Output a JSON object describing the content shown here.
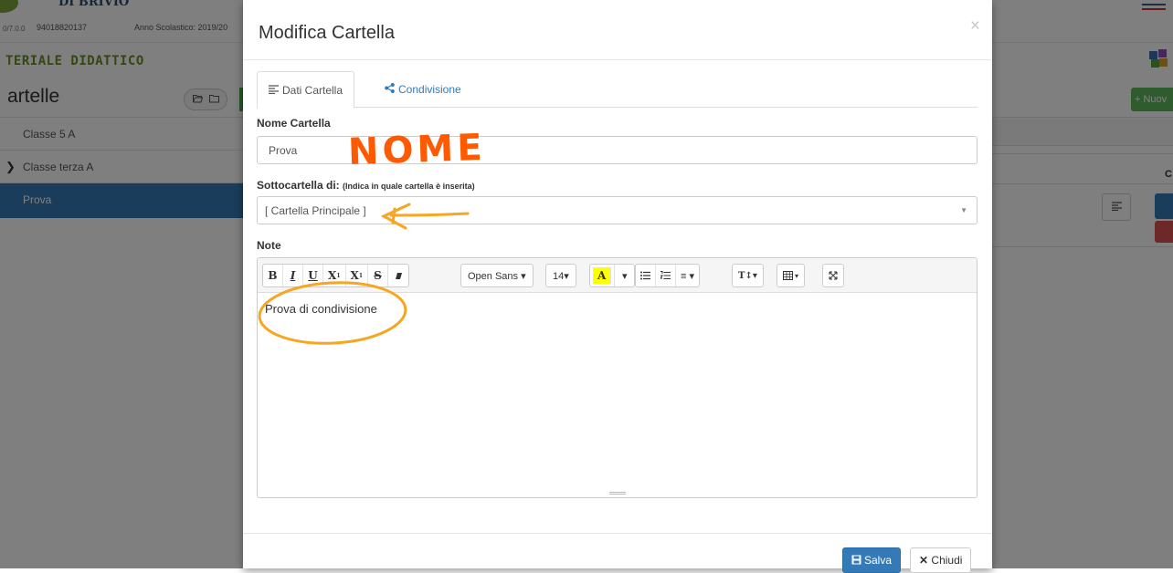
{
  "app": {
    "school_name": "DI BRIVIO",
    "version": "0/7.0.0",
    "code": "94018820137",
    "anno": "Anno Scolastico: 2019/20",
    "section_title": "TERIALE DIDATTICO",
    "list_title": "artelle",
    "new_button": "+ Nuov",
    "column_letter": "C",
    "folders": [
      {
        "label": "Classe 5 A",
        "expandable": false,
        "active": false
      },
      {
        "label": "Classe terza A",
        "expandable": true,
        "active": false
      },
      {
        "label": "Prova",
        "expandable": false,
        "active": true
      }
    ],
    "icons": {
      "folder_open": "folder-open-icon",
      "folder": "folder-icon",
      "puzzle": "puzzle-icon",
      "menu": "align-icon"
    }
  },
  "modal": {
    "title": "Modifica Cartella",
    "close": "×",
    "tabs": [
      {
        "label": "Dati Cartella",
        "icon": "align-left-icon",
        "active": true
      },
      {
        "label": "Condivisione",
        "icon": "share-icon",
        "active": false
      }
    ],
    "name_label": "Nome Cartella",
    "name_value": "Prova",
    "parent_label": "Sottocartella di:",
    "parent_hint": "(Indica in quale cartella è inserita)",
    "parent_value": "[ Cartella Principale ]",
    "note_label": "Note",
    "note_content": "Prova di condivisione",
    "toolbar": {
      "bold": "B",
      "italic": "I",
      "underline": "U",
      "superscript": "X",
      "subscript": "X",
      "strike": "S",
      "eraser": "eraser-icon",
      "font_family": "Open Sans ▾",
      "font_size": "14▾",
      "color": "A",
      "color_caret": "▾",
      "ul": "list-ul-icon",
      "ol": "list-ol-icon",
      "align": "≡ ▾",
      "line_height": "T↕▾",
      "table": "table-icon",
      "fullscreen": "fullscreen-icon"
    },
    "save_label": "Salva",
    "close_label": "Chiudi"
  },
  "annotations": {
    "handwritten_text": "NOME",
    "color_handwriting": "#ff5a00",
    "color_arrow_circle": "#f6a623"
  }
}
